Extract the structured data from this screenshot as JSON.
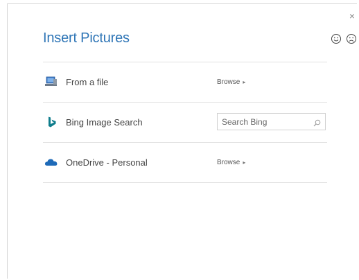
{
  "dialog": {
    "title": "Insert Pictures",
    "close_label": "×"
  },
  "feedback": {
    "smile_icon": "smile-icon",
    "frown_icon": "frown-icon"
  },
  "rows": [
    {
      "icon": "computer-icon",
      "label": "From a file",
      "action_label": "Browse",
      "action_arrow": "▸"
    },
    {
      "icon": "bing-icon",
      "label": "Bing Image Search",
      "placeholder": "Search Bing",
      "search_icon": "magnifier-icon"
    },
    {
      "icon": "onedrive-icon",
      "label": "OneDrive - Personal",
      "action_label": "Browse",
      "action_arrow": "▸"
    }
  ],
  "colors": {
    "title": "#2e75b6",
    "bing": "#0f7d8c",
    "onedrive": "#1e6ab8"
  }
}
